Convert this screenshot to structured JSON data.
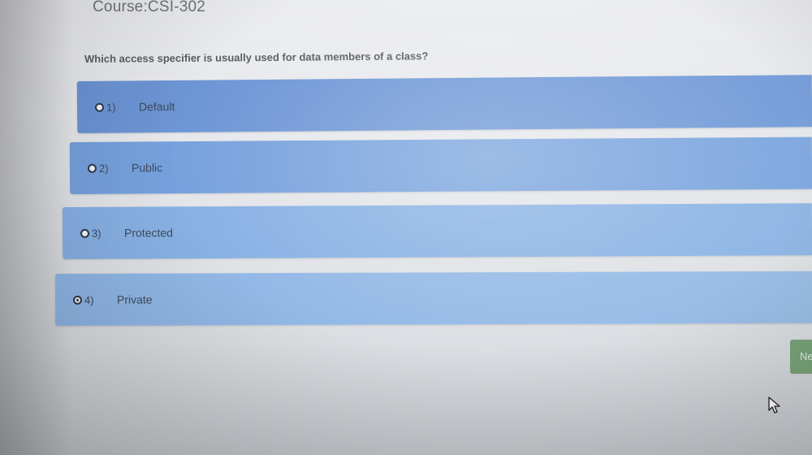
{
  "course": {
    "title": "Course:CSI-302"
  },
  "question": {
    "text": "Which access specifier is usually used for data members of a class?"
  },
  "options": [
    {
      "number": "1)",
      "label": "Default",
      "selected": false
    },
    {
      "number": "2)",
      "label": "Public",
      "selected": false
    },
    {
      "number": "3)",
      "label": "Protected",
      "selected": false
    },
    {
      "number": "4)",
      "label": "Private",
      "selected": true
    }
  ],
  "navigation": {
    "next_label": "Ne"
  },
  "colors": {
    "option_blue": "#79a0da",
    "next_green": "#7aa57a"
  },
  "icons": {
    "cursor": "mouse-pointer-icon"
  }
}
